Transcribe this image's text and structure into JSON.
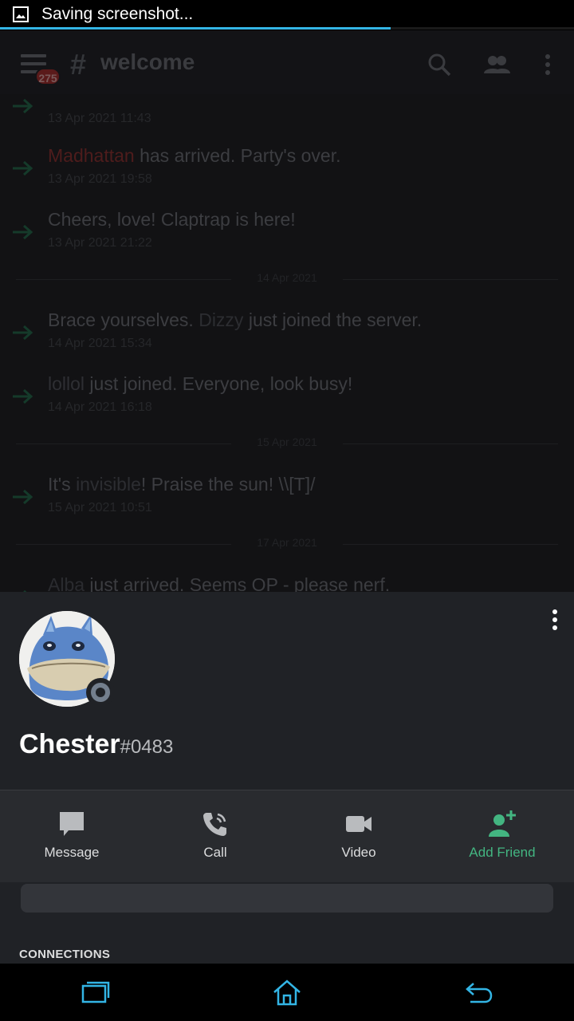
{
  "status_bar": {
    "notification_text": "Saving screenshot...",
    "progress": 0.68,
    "progress_color": "#33b5e5"
  },
  "chat": {
    "unread_badge": "275",
    "channel_name": "welcome",
    "messages_top": [
      {
        "name": "Madhattan",
        "text": " has arrived. Party's over.",
        "time": "13 Apr 2021 19:58"
      },
      {
        "name": "",
        "text": "Cheers, love! Claptrap is here!",
        "time": "13 Apr 2021 21:22"
      }
    ],
    "date_divider_1": "14 Apr 2021",
    "messages_mid": [
      {
        "prefix": "Brace yourselves. ",
        "name": "Dizzy",
        "text": " just joined the server.",
        "time": "14 Apr 2021 15:34"
      },
      {
        "prefix": "",
        "name": "lollol",
        "text": " just joined. Everyone, look busy!",
        "time": "14 Apr 2021 16:18"
      }
    ],
    "date_divider_2": "15 Apr 2021",
    "message_invisible": {
      "prefix": "It's ",
      "name": "invisible",
      "text": "! Praise the sun! \\\\[T]/",
      "time": "15 Apr 2021 10:51"
    },
    "date_divider_3": "17 Apr 2021",
    "message_last": {
      "name": "Alba",
      "text": " just arrived. Seems OP - please nerf."
    },
    "cut_off_time": "13 Apr 2021 11:43"
  },
  "profile": {
    "username": "Chester",
    "discriminator": "#0483",
    "status": "offline",
    "actions": [
      {
        "label": "Message",
        "icon": "message-icon"
      },
      {
        "label": "Call",
        "icon": "call-icon"
      },
      {
        "label": "Video",
        "icon": "video-icon"
      },
      {
        "label": "Add Friend",
        "icon": "add-friend-icon"
      }
    ],
    "accent_green": "#43b581",
    "connections_heading": "CONNECTIONS"
  },
  "nav": {
    "icons": [
      "recent-apps-icon",
      "home-icon",
      "back-icon"
    ],
    "icon_color": "#33b5e5"
  }
}
